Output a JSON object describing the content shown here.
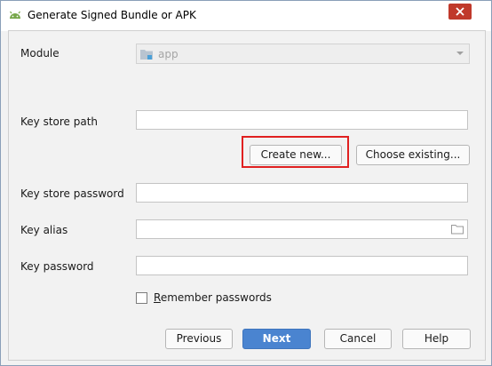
{
  "window": {
    "title": "Generate Signed Bundle or APK"
  },
  "fields": {
    "module_label": "Module",
    "module_value": "app",
    "key_store_path_label": "Key store path",
    "key_store_password_label": "Key store password",
    "key_alias_label": "Key alias",
    "key_password_label": "Key password"
  },
  "buttons": {
    "create_new": "Create new...",
    "choose_existing": "Choose existing...",
    "previous": "Previous",
    "next": "Next",
    "cancel": "Cancel",
    "help": "Help"
  },
  "remember": {
    "mnemonic": "R",
    "rest": "emember passwords",
    "checked": false
  },
  "icons": {
    "title": "android-icon",
    "close": "close-icon",
    "module": "module-folder-icon",
    "dropdown": "chevron-down-icon",
    "browse": "folder-icon"
  },
  "colors": {
    "primary_button": "#4a84d0",
    "highlight_box": "#e02020",
    "close_button": "#c0392b"
  }
}
